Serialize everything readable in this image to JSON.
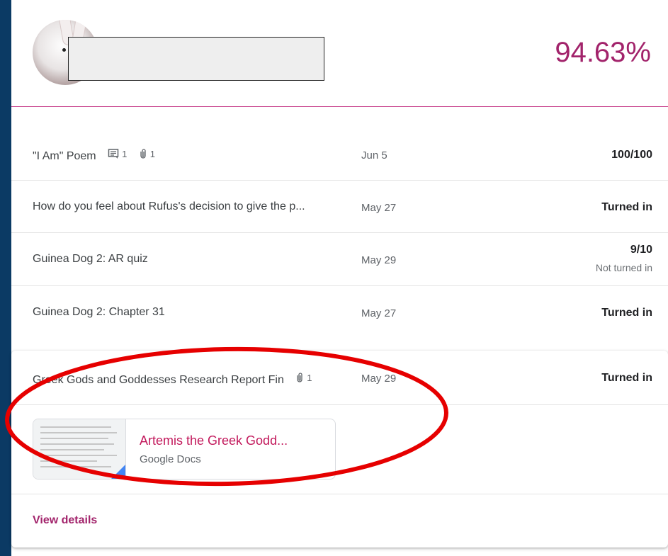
{
  "header": {
    "student_name": "",
    "overall_grade": "94.63%"
  },
  "assignments": [
    {
      "title": "\"I Am\" Poem",
      "comments": "1",
      "attachments": "1",
      "date": "Jun 5",
      "status": "100/100",
      "substatus": ""
    },
    {
      "title": "How do you feel about Rufus's decision to give the p...",
      "comments": "",
      "attachments": "",
      "date": "May 27",
      "status": "Turned in",
      "substatus": ""
    },
    {
      "title": "Guinea Dog 2: AR quiz",
      "comments": "",
      "attachments": "",
      "date": "May 29",
      "status": "9/10",
      "substatus": "Not turned in"
    },
    {
      "title": "Guinea Dog 2: Chapter 31",
      "comments": "",
      "attachments": "",
      "date": "May 27",
      "status": "Turned in",
      "substatus": ""
    }
  ],
  "expanded": {
    "title": "Greek Gods and Goddesses Research Report Fin",
    "attachments": "1",
    "date": "May 29",
    "status": "Turned in",
    "attachment": {
      "name": "Artemis the Greek Godd...",
      "type": "Google Docs"
    },
    "view_details_label": "View details"
  },
  "colors": {
    "accent": "#a2236b",
    "attachment_link": "#c2185b",
    "annotation": "#e60000",
    "background": "#0b3a64"
  }
}
